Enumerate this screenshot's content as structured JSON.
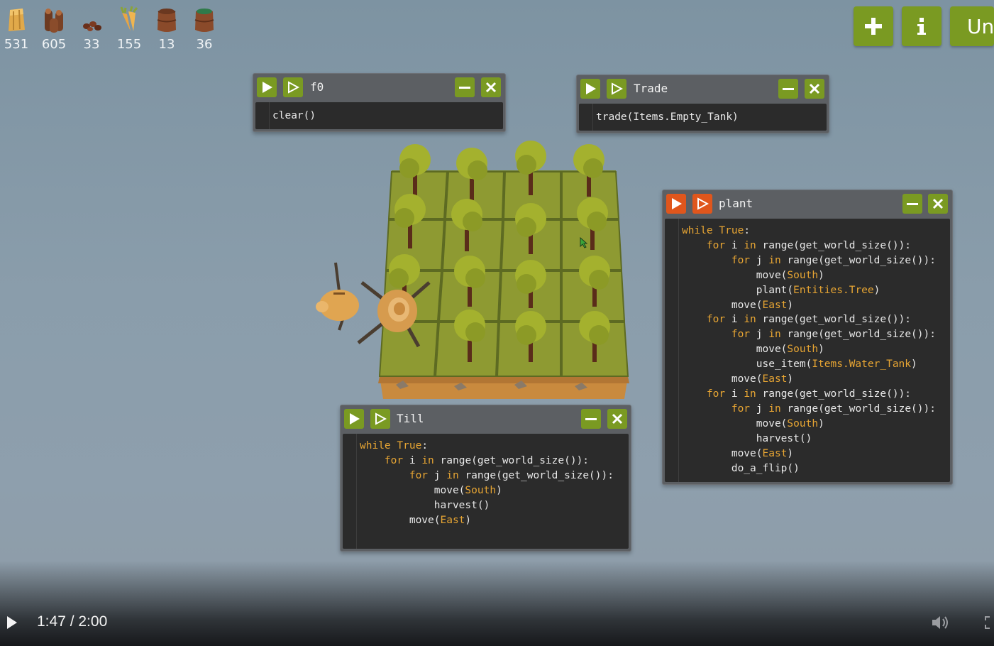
{
  "resources": [
    {
      "icon": "hay-icon",
      "count": "531"
    },
    {
      "icon": "wood-logs-icon",
      "count": "605"
    },
    {
      "icon": "seeds-icon",
      "count": "33"
    },
    {
      "icon": "carrot-icon",
      "count": "155"
    },
    {
      "icon": "empty-tank-icon",
      "count": "13"
    },
    {
      "icon": "water-tank-icon",
      "count": "36"
    }
  ],
  "toolbar": {
    "add_icon": "plus-icon",
    "info_icon": "info-icon",
    "third_label": "Un"
  },
  "windows": {
    "f0": {
      "title": "f0",
      "code": [
        "clear()"
      ]
    },
    "trade": {
      "title": "Trade",
      "code": [
        "trade(Items.Empty_Tank)"
      ]
    },
    "plant": {
      "title": "plant"
    },
    "till": {
      "title": "Till"
    }
  },
  "video": {
    "time": "1:47 / 2:00"
  },
  "colors": {
    "button_green": "#7a9a22",
    "button_orange": "#e0561c",
    "keyword": "#e7a533",
    "editor_bg": "#2b2b2b"
  }
}
